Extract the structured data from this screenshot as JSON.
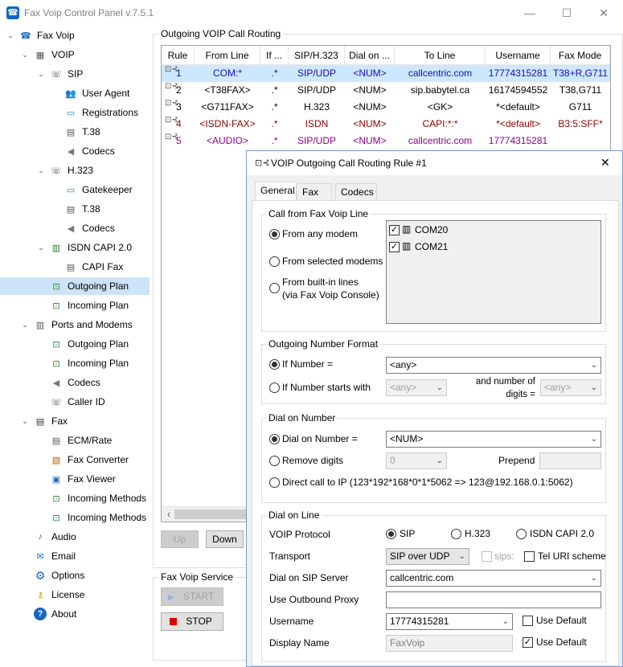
{
  "window": {
    "title": "Fax Voip Control Panel v.7.5.1",
    "minimize": "—",
    "maximize": "☐",
    "close": "✕"
  },
  "tree": [
    {
      "label": "Fax Voip",
      "icon": "phone-icon",
      "level": 0,
      "toggle": "⌄"
    },
    {
      "label": "VOIP",
      "icon": "voip-icon",
      "level": 1,
      "toggle": "⌄"
    },
    {
      "label": "SIP",
      "icon": "sip-phone-icon",
      "level": 2,
      "toggle": "⌄"
    },
    {
      "label": "User Agent",
      "icon": "user-agent-icon",
      "level": 3
    },
    {
      "label": "Registrations",
      "icon": "registrations-icon",
      "level": 3
    },
    {
      "label": "T.38",
      "icon": "fax-machine-icon",
      "level": 3
    },
    {
      "label": "Codecs",
      "icon": "speaker-icon",
      "level": 3
    },
    {
      "label": "H.323",
      "icon": "h323-phone-icon",
      "level": 2,
      "toggle": "⌄"
    },
    {
      "label": "Gatekeeper",
      "icon": "gatekeeper-icon",
      "level": 3
    },
    {
      "label": "T.38",
      "icon": "fax-machine-icon",
      "level": 3
    },
    {
      "label": "Codecs",
      "icon": "speaker-icon",
      "level": 3
    },
    {
      "label": "ISDN CAPI 2.0",
      "icon": "isdn-card-icon",
      "level": 2,
      "toggle": "⌄"
    },
    {
      "label": "CAPI Fax",
      "icon": "fax-machine-icon",
      "level": 3
    },
    {
      "label": "Outgoing Plan",
      "icon": "routing-plan-icon",
      "level": 2,
      "selected": true
    },
    {
      "label": "Incoming Plan",
      "icon": "routing-plan-icon",
      "level": 2
    },
    {
      "label": "Ports and Modems",
      "icon": "ports-icon",
      "level": 1,
      "toggle": "⌄"
    },
    {
      "label": "Outgoing Plan",
      "icon": "routing-plan-icon",
      "level": 2
    },
    {
      "label": "Incoming Plan",
      "icon": "routing-plan-icon",
      "level": 2
    },
    {
      "label": "Codecs",
      "icon": "speaker-icon",
      "level": 2
    },
    {
      "label": "Caller ID",
      "icon": "caller-id-icon",
      "level": 2
    },
    {
      "label": "Fax",
      "icon": "fax-icon",
      "level": 1,
      "toggle": "⌄"
    },
    {
      "label": "ECM/Rate",
      "icon": "fax-machine-icon",
      "level": 2
    },
    {
      "label": "Fax Converter",
      "icon": "fax-converter-icon",
      "level": 2
    },
    {
      "label": "Fax Viewer",
      "icon": "fax-viewer-icon",
      "level": 2
    },
    {
      "label": "Incoming Methods",
      "icon": "routing-plan-icon",
      "level": 2
    },
    {
      "label": "Incoming Methods",
      "icon": "routing-plan-icon",
      "level": 2
    },
    {
      "label": "Audio",
      "icon": "music-note-icon",
      "level": 1
    },
    {
      "label": "Email",
      "icon": "email-icon",
      "level": 1
    },
    {
      "label": "Options",
      "icon": "gear-icon",
      "level": 1
    },
    {
      "label": "License",
      "icon": "key-icon",
      "level": 1
    },
    {
      "label": "About",
      "icon": "help-icon",
      "level": 1
    }
  ],
  "routing": {
    "group_title": "Outgoing VOIP Call Routing",
    "columns": [
      "Rule",
      "From Line",
      "If ...",
      "SIP/H.323",
      "Dial on ...",
      "To Line",
      "Username",
      "Fax Mode"
    ],
    "rows": [
      {
        "cells": [
          "1",
          "COM:*",
          ".*",
          "SIP/UDP",
          "<NUM>",
          "callcentric.com",
          "17774315281",
          "T38+R,G711"
        ],
        "color": "#1a0dab",
        "selected": true
      },
      {
        "cells": [
          "2",
          "<T38FAX>",
          ".*",
          "SIP/UDP",
          "<NUM>",
          "sip.babytel.ca",
          "16174594552",
          "T38,G711"
        ],
        "color": "#000000"
      },
      {
        "cells": [
          "3",
          "<G711FAX>",
          ".*",
          "H.323",
          "<NUM>",
          "<GK>",
          "*<default>",
          "G711"
        ],
        "color": "#000000"
      },
      {
        "cells": [
          "4",
          "<ISDN-FAX>",
          ".*",
          "ISDN",
          "<NUM>",
          "CAPI:*:*",
          "*<default>",
          "B3:5:SFF*"
        ],
        "color": "#8b0000"
      },
      {
        "cells": [
          "5",
          "<AUDIO>",
          ".*",
          "SIP/UDP",
          "<NUM>",
          "callcentric.com",
          "17774315281",
          ""
        ],
        "color": "#8b008b"
      }
    ],
    "scroll_left": "‹",
    "up_button": "Up",
    "down_button": "Down"
  },
  "service": {
    "group_title": "Fax Voip Service",
    "start": "START",
    "stop": "STOP"
  },
  "dialog": {
    "title": "VOIP Outgoing Call Routing Rule #1",
    "close": "✕",
    "tabs": [
      "General",
      "Fax",
      "Codecs"
    ],
    "call_from": {
      "title": "Call from Fax Voip Line",
      "any_modem": "From any modem",
      "selected_modems": "From selected modems",
      "builtin_1": "From built-in lines",
      "builtin_2": "(via Fax Voip Console)",
      "ports": [
        "COM20",
        "COM21"
      ]
    },
    "number_format": {
      "title": "Outgoing Number Format",
      "if_number": "If Number =",
      "if_number_value": "<any>",
      "starts_with": "If Number starts with",
      "starts_with_value": "<any>",
      "digits_label_1": "and number of",
      "digits_label_2": "digits =",
      "digits_value": "<any>"
    },
    "dial_number": {
      "title": "Dial on Number",
      "dial_on_number": "Dial on Number =",
      "dial_value": "<NUM>",
      "remove_digits": "Remove digits",
      "remove_value": "0",
      "prepend": "Prepend",
      "direct_ip": "Direct call to IP (123*192*168*0*1*5062 => 123@192.168.0.1:5062)"
    },
    "dial_line": {
      "title": "Dial on Line",
      "protocol_label": "VOIP Protocol",
      "sip": "SIP",
      "h323": "H.323",
      "isdn": "ISDN CAPI 2.0",
      "transport_label": "Transport",
      "transport_value": "SIP over UDP",
      "sips": "sips:",
      "tel_uri": "Tel URI scheme",
      "server_label": "Dial on SIP Server",
      "server_value": "callcentric.com",
      "proxy_label": "Use Outbound Proxy",
      "username_label": "Username",
      "username_value": "17774315281",
      "use_default_1": "Use Default",
      "display_label": "Display Name",
      "display_value": "FaxVoip",
      "use_default_2": "Use Default"
    }
  },
  "colors": {
    "selection": "#cde3f7",
    "list_selection": "#cce8ff",
    "accent": "#1565c0",
    "stop_red": "#e00000",
    "play_blue": "#3b8ad9"
  }
}
